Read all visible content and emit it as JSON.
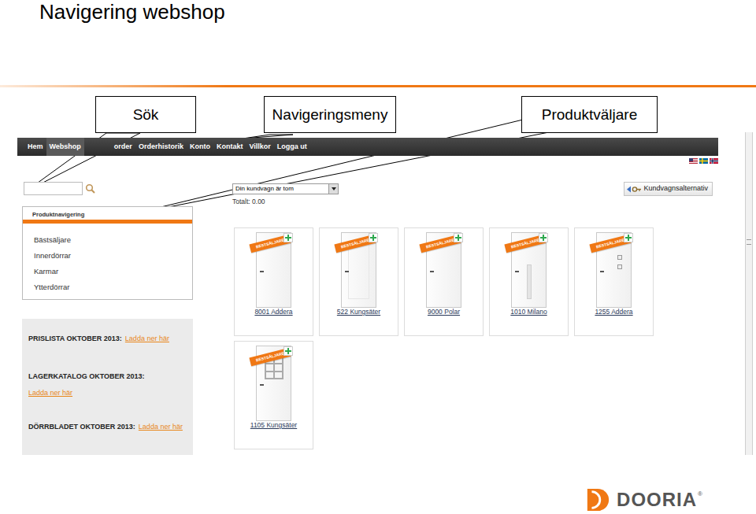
{
  "slide": {
    "title": "Navigering webshop"
  },
  "callouts": [
    {
      "label": "Sök"
    },
    {
      "label": "Navigeringsmeny"
    },
    {
      "label": "Produktväljare"
    }
  ],
  "navbar": {
    "items": [
      {
        "label": "Hem",
        "selected": false
      },
      {
        "label": "Webshop",
        "selected": true
      },
      {
        "label": "order",
        "selected": false
      },
      {
        "label": "Orderhistorik",
        "selected": false
      },
      {
        "label": "Konto",
        "selected": false
      },
      {
        "label": "Kontakt",
        "selected": false
      },
      {
        "label": "Villkor",
        "selected": false
      },
      {
        "label": "Logga ut",
        "selected": false
      }
    ]
  },
  "cart": {
    "dropdown": "Din kundvagn är tom",
    "total": "Totalt: 0.00",
    "options_button": "Kundvagnsalternativ"
  },
  "product_nav": {
    "title": "Produktnavigering",
    "items": [
      "Bästsäljare",
      "Innerdörrar",
      "Karmar",
      "Ytterdörrar"
    ]
  },
  "downloads": [
    {
      "label": "PRISLISTA OKTOBER 2013:",
      "link": "Ladda ner här",
      "kind": "inline"
    },
    {
      "label": "LAGERKATALOG OKTOBER 2013:",
      "link": "Ladda ner här",
      "kind": "stacked"
    },
    {
      "label": "DÖRRBLADET OKTOBER 2013:",
      "link": "Ladda ner här",
      "kind": "inline"
    }
  ],
  "products": [
    {
      "name": "8001 Addera",
      "badge": "BESTSÄLJARE",
      "kind": "plain"
    },
    {
      "name": "522 Kungsäter",
      "badge": "BESTSÄLJARE",
      "kind": "panel"
    },
    {
      "name": "9000 Polar",
      "badge": "BESTSÄLJARE",
      "kind": "plain"
    },
    {
      "name": "1010 Milano",
      "badge": "BESTSÄLJARE",
      "kind": "strip"
    },
    {
      "name": "1255 Addera",
      "badge": "BESTSÄLJARE",
      "kind": "squares"
    },
    {
      "name": "1105 Kungsäter",
      "badge": "BESTSÄLJARE",
      "kind": "grid"
    }
  ],
  "logo": {
    "text": "DOORIA",
    "mark": "®"
  }
}
